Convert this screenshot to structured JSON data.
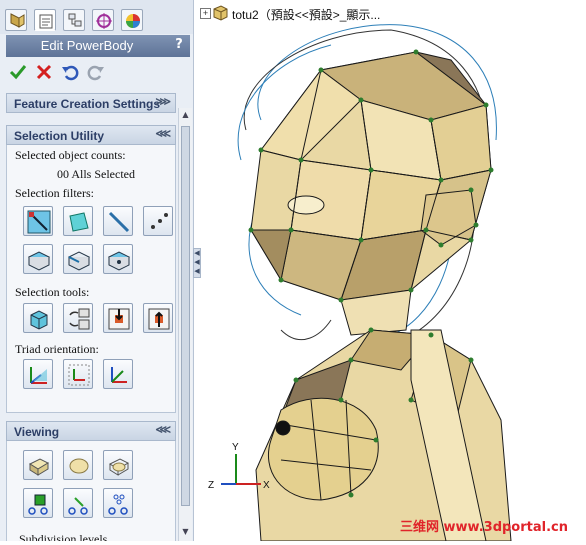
{
  "tabs": [
    {
      "name": "feature-manager-tab"
    },
    {
      "name": "property-manager-tab"
    },
    {
      "name": "configuration-manager-tab"
    },
    {
      "name": "dimxpert-tab"
    },
    {
      "name": "display-manager-tab"
    }
  ],
  "panel": {
    "title": "Edit PowerBody",
    "help": "?"
  },
  "sections": {
    "feature_creation": "Feature Creation Settings",
    "selection_utility": "Selection Utility",
    "viewing": "Viewing"
  },
  "selection": {
    "counts_label": "Selected object counts:",
    "counts_value": "00 Alls Selected",
    "filters_label": "Selection filters:",
    "tools_label": "Selection tools:",
    "triad_label": "Triad orientation:"
  },
  "viewing": {
    "subdivision_label": "Subdivision levels"
  },
  "tree": {
    "expander": "+",
    "label": "totu2（預設<<預設>_顯示..."
  },
  "triad": {
    "x": "X",
    "y": "Y",
    "z": "Z"
  },
  "watermark": "三维网 www.3dportal.cn",
  "colors": {
    "accent": "#5e7397",
    "accept": "#2a9a2a",
    "cancel": "#d42020",
    "model_face": "#e9d8a4",
    "model_dark": "#8a7658",
    "cage_point": "#2e7d2e"
  }
}
